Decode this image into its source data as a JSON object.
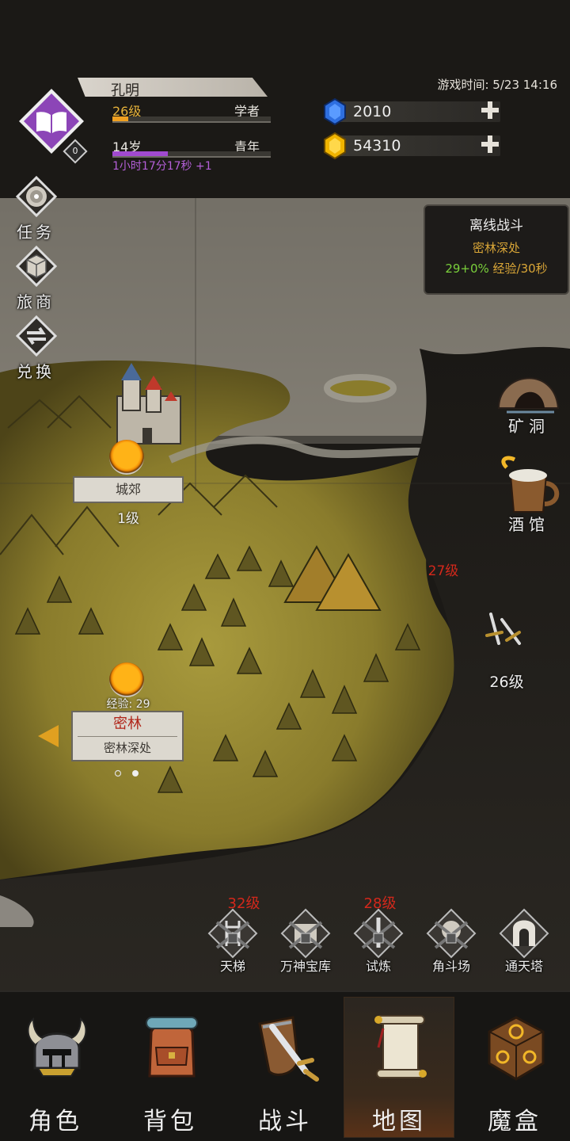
{
  "header": {
    "player_name": "孔明",
    "level_text": "26级",
    "class_text": "学者",
    "age_text": "14岁",
    "stage_text": "青年",
    "level_progress": 0.1,
    "age_progress": 0.35,
    "age_timer": "1小时17分17秒 +1",
    "badge_number": "0",
    "game_time": "游戏时间: 5/23 14:16",
    "avatar_icon": "book-icon"
  },
  "currencies": [
    {
      "name": "gem",
      "value": "2010",
      "color": "#2e6fe0"
    },
    {
      "name": "gold",
      "value": "54310",
      "color": "#f0b400"
    }
  ],
  "side_buttons": [
    {
      "label": "任务",
      "icon": "quest-target-icon"
    },
    {
      "label": "旅商",
      "icon": "merchant-box-icon"
    },
    {
      "label": "兑换",
      "icon": "exchange-icon"
    }
  ],
  "offline_battle": {
    "title": "离线战斗",
    "location": "密林深处",
    "rate_green": "29+0%",
    "rate_text": " 经验/30秒"
  },
  "map": {
    "outskirts": {
      "name": "城郊",
      "level": "1级"
    },
    "forest": {
      "name": "密林",
      "sub": "密林深处",
      "exp": "经验: 29"
    },
    "cave": {
      "label": "矿洞"
    },
    "tavern": {
      "label": "酒馆"
    },
    "unknown_level": "27级",
    "battle_level": "26级"
  },
  "dungeons": [
    {
      "label": "天梯",
      "level": "32级",
      "icon": "ladder-icon"
    },
    {
      "label": "万神宝库",
      "level": "",
      "icon": "treasury-icon"
    },
    {
      "label": "试炼",
      "level": "28级",
      "icon": "trial-icon"
    },
    {
      "label": "角斗场",
      "level": "",
      "icon": "arena-icon"
    },
    {
      "label": "通天塔",
      "level": "",
      "icon": "tower-icon"
    }
  ],
  "nav": [
    {
      "label": "角色",
      "icon": "helmet-icon"
    },
    {
      "label": "背包",
      "icon": "backpack-icon"
    },
    {
      "label": "战斗",
      "icon": "shield-sword-icon"
    },
    {
      "label": "地图",
      "icon": "scroll-map-icon",
      "active": true
    },
    {
      "label": "魔盒",
      "icon": "magic-box-icon"
    }
  ]
}
